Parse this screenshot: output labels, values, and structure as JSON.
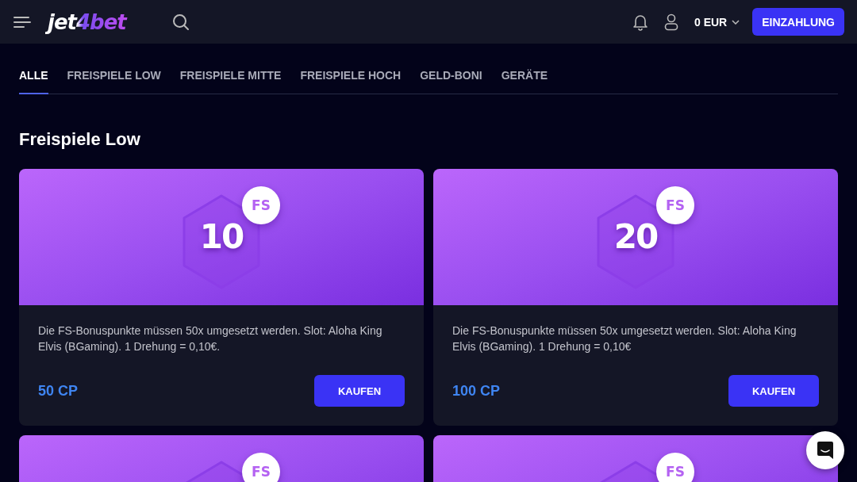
{
  "header": {
    "logo": "jet4bet",
    "balance": "0 EUR",
    "deposit_button": "EINZAHLUNG"
  },
  "tabs": [
    {
      "label": "ALLE",
      "selected": true
    },
    {
      "label": "FREISPIELE LOW",
      "selected": false
    },
    {
      "label": "FREISPIELE MITTE",
      "selected": false
    },
    {
      "label": "FREISPIELE HOCH",
      "selected": false
    },
    {
      "label": "GELD-BONI",
      "selected": false
    },
    {
      "label": "GERÄTE",
      "selected": false
    }
  ],
  "section_title": "Freispiele Low",
  "cards": [
    {
      "amount": "10",
      "badge": "FS",
      "description": "Die FS-Bonuspunkte müssen 50x umgesetzt werden. Slot: Aloha King Elvis (BGaming). 1 Drehung = 0,10€.",
      "price": "50 CP",
      "button": "KAUFEN"
    },
    {
      "amount": "20",
      "badge": "FS",
      "description": "Die FS-Bonuspunkte müssen 50x umgesetzt werden. Slot: Aloha King Elvis (BGaming). 1 Drehung = 0,10€",
      "price": "100 CP",
      "button": "KAUFEN"
    },
    {
      "badge": "FS"
    },
    {
      "badge": "FS"
    }
  ]
}
